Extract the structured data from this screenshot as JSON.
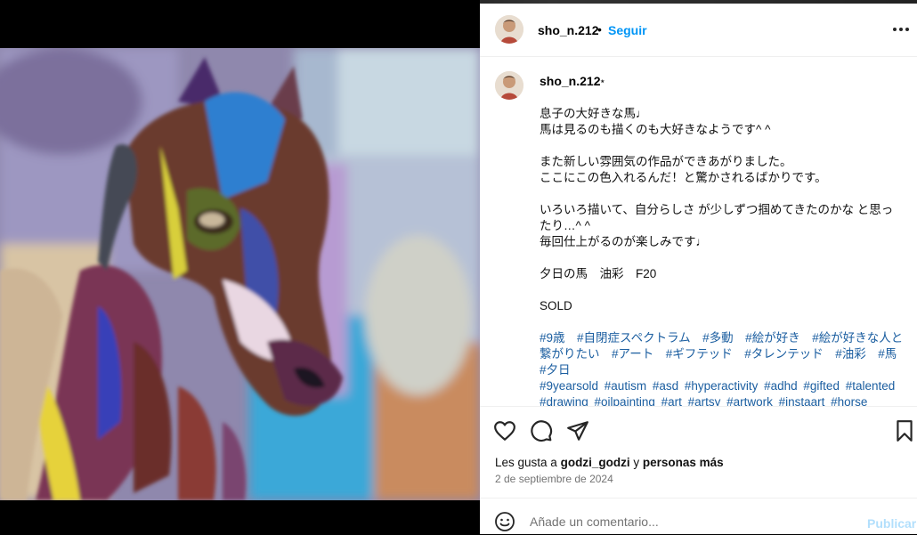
{
  "post": {
    "username": "sho_n.212",
    "follow_label": "Seguir",
    "separator": "•",
    "badge": "⋆"
  },
  "caption": {
    "lines": [
      "息子の大好きな馬♩",
      "馬は見るのも描くのも大好きなようです^ ^",
      "",
      "また新しい雰囲気の作品ができあがりました。",
      "ここにこの色入れるんだ！と驚かされるばかりです。",
      "",
      "いろいろ描いて、自分らしさ が少しずつ掴めてきたのかな と思ったり…^ ^",
      "毎回仕上がるのが楽しみです♩",
      "",
      "夕日の馬　油彩　F20",
      "",
      "SOLD",
      ""
    ],
    "hashtags_jp": "#9歳　#自閉症スペクトラム　#多動　#絵が好き　#絵が好きな人と繋がりたい　#アート　#ギフテッド　#タレンテッド　#油彩　#馬　#夕日",
    "hashtags_en": "#9yearsold #autism #asd #hyperactivity #adhd #gifted #talented #drawing #oilpainting #art #artsy #artwork #instaart #horse"
  },
  "likes": {
    "prefix": "Les gusta a",
    "user": "godzi_godzi",
    "middle": "y",
    "rest": "personas más"
  },
  "date": "2 de septiembre de 2024",
  "comment": {
    "placeholder": "Añade un comentario...",
    "publish_label": "Publicar"
  },
  "icons": {
    "more": "more-options-icon",
    "like": "heart-icon",
    "comment": "comment-icon",
    "share": "share-icon",
    "save": "bookmark-icon",
    "emoji": "emoji-icon"
  },
  "colors": {
    "accent": "#0095f6",
    "hashtag": "#1b5ea0",
    "publish_disabled": "#b2dffc"
  }
}
